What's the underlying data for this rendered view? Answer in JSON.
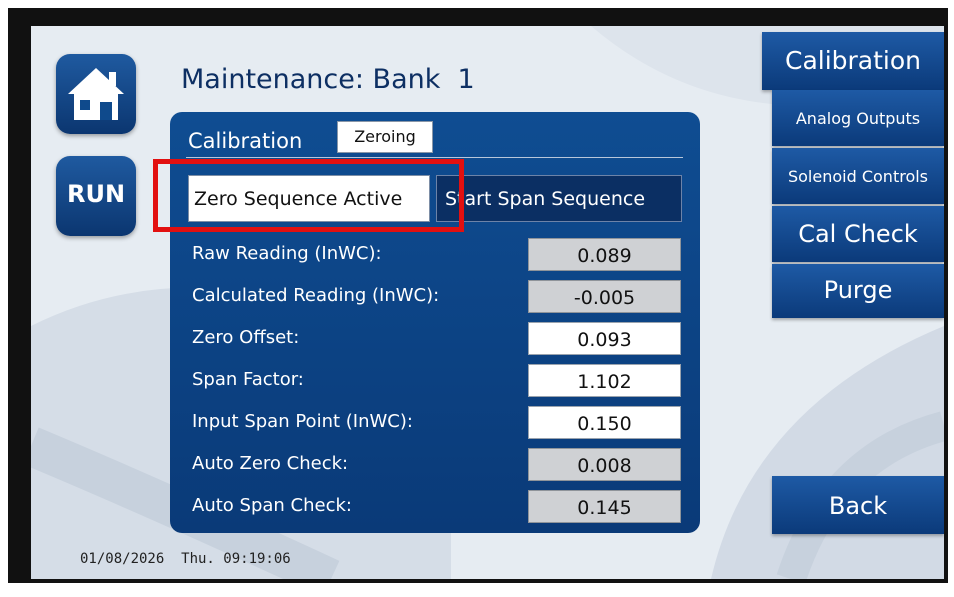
{
  "header": {
    "title": "Maintenance: Bank  1"
  },
  "left": {
    "run_label": "RUN"
  },
  "panel": {
    "section_label": "Calibration",
    "mode_value": "Zeroing",
    "zero_sequence_label": "Zero Sequence Active",
    "span_sequence_label": "Start Span Sequence"
  },
  "readings": [
    {
      "label": "Raw Reading (InWC):",
      "value": "0.089",
      "editable": false
    },
    {
      "label": "Calculated Reading (InWC):",
      "value": "-0.005",
      "editable": false
    },
    {
      "label": "Zero Offset:",
      "value": "0.093",
      "editable": true
    },
    {
      "label": "Span Factor:",
      "value": "1.102",
      "editable": true
    },
    {
      "label": "Input Span Point (InWC):",
      "value": "0.150",
      "editable": true
    },
    {
      "label": "Auto Zero Check:",
      "value": "0.008",
      "editable": false
    },
    {
      "label": "Auto Span Check:",
      "value": "0.145",
      "editable": false
    }
  ],
  "nav": {
    "calibration": "Calibration",
    "analog_outputs": "Analog Outputs",
    "solenoid_controls": "Solenoid Controls",
    "cal_check": "Cal Check",
    "purge": "Purge",
    "back": "Back"
  },
  "status": {
    "datetime": "01/08/2026  Thu. 09:19:06"
  },
  "colors": {
    "panel_blue": "#0f4d92",
    "nav_blue": "#1e5aa5",
    "highlight_red": "#e21010",
    "readonly_gray": "#cfd1d4"
  },
  "icons": {
    "home": "home-icon"
  }
}
